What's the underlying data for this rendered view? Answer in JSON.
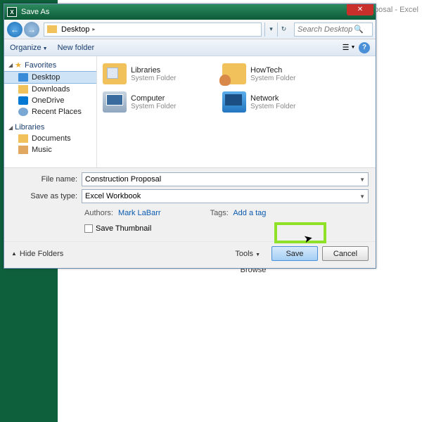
{
  "bgTitle": "oposal - Excel",
  "browse": {
    "label": "Browse"
  },
  "dialog": {
    "title": "Save As",
    "closeGlyph": "✕",
    "nav": {
      "backGlyph": "←",
      "fwdGlyph": "→",
      "location": "Desktop",
      "chev": "▸",
      "ddGlyph": "▾",
      "refreshGlyph": "↻"
    },
    "search": {
      "placeholder": "Search Desktop",
      "icon": "🔍"
    },
    "toolbar": {
      "organize": "Organize",
      "newFolder": "New folder",
      "viewGlyph": "☰",
      "helpGlyph": "?"
    },
    "sidebar": {
      "favorites": "Favorites",
      "favItems": [
        {
          "label": "Desktop",
          "iconCls": "ico-desktop",
          "sel": true
        },
        {
          "label": "Downloads",
          "iconCls": "ico-folder"
        },
        {
          "label": "OneDrive",
          "iconCls": "ico-cloud"
        },
        {
          "label": "Recent Places",
          "iconCls": "ico-clock"
        }
      ],
      "libraries": "Libraries",
      "libItems": [
        {
          "label": "Documents",
          "iconCls": "ico-folder"
        },
        {
          "label": "Music",
          "iconCls": "ico-music"
        }
      ]
    },
    "items": [
      {
        "name": "Libraries",
        "sub": "System Folder",
        "iconCls": "ico-libfolder"
      },
      {
        "name": "HowTech",
        "sub": "System Folder",
        "iconCls": "ico-howtech"
      },
      {
        "name": "Computer",
        "sub": "System Folder",
        "iconCls": "ico-comp"
      },
      {
        "name": "Network",
        "sub": "System Folder",
        "iconCls": "ico-net"
      }
    ],
    "form": {
      "fileNameLabel": "File name:",
      "fileName": "Construction Proposal",
      "typeLabel": "Save as type:",
      "type": "Excel Workbook",
      "authorsLabel": "Authors:",
      "authors": "Mark LaBarr",
      "tagsLabel": "Tags:",
      "tags": "Add a tag",
      "saveThumb": "Save Thumbnail"
    },
    "footer": {
      "hideFolders": "Hide Folders",
      "tools": "Tools",
      "save": "Save",
      "cancel": "Cancel"
    }
  }
}
